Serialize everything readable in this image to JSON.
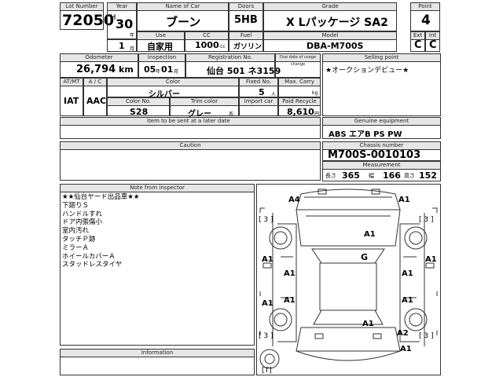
{
  "header": {
    "lot_number_label": "Lot Number",
    "lot_number": "72050",
    "year_label": "Year",
    "year_era": "H",
    "year_value": "30",
    "year_suffix": "年",
    "month_value": "1",
    "month_suffix": "月",
    "name_label": "Name of Car",
    "name_value": "ブーン",
    "use_label": "Use",
    "use_value": "自家用",
    "cc_label": "CC",
    "cc_value": "1000",
    "cc_unit": "cc",
    "doors_label": "Doors",
    "doors_value": "5HB",
    "fuel_label": "Fuel",
    "fuel_value": "ガソリン",
    "grade_label": "Grade",
    "grade_value": "X Lパッケージ SA2",
    "model_label": "Model",
    "model_value": "DBA-M700S",
    "point_label": "Point",
    "point_value": "4",
    "ext_label": "Ext",
    "ext_value": "C",
    "int_label": "Int",
    "int_value": "C"
  },
  "details": {
    "odometer_label": "Odometer",
    "odometer_value": "26,794",
    "odometer_unit": "km",
    "inspection_label": "Inspection",
    "inspection_year": "05",
    "inspection_year_suffix": "年",
    "inspection_month": "01",
    "inspection_month_suffix": "月",
    "registration_label": "Registration No.",
    "registration_value": "仙台 501 ネ3159",
    "due_date_label": "Due date of usage change",
    "selling_point_label": "Selling point",
    "selling_point_value": "★オークションデビュー★",
    "atmt_label": "AT/MT",
    "atmt_value": "IAT",
    "ac_label": "A / C",
    "ac_value": "AAC",
    "color_label": "Color",
    "color_value": "シルバー",
    "fixed_no_label": "Fixed No.",
    "fixed_no_value": "5",
    "fixed_no_unit": "人",
    "max_carry_label": "Max. Carry",
    "max_carry_unit": "kg",
    "color_no_label": "Color No.",
    "color_no_value": "S28",
    "trim_color_label": "Trim color",
    "trim_color_value": "グレー",
    "trim_color_unit": "系",
    "import_car_label": "Import car",
    "recycle_label": "Paid Recycle",
    "recycle_value": "8,610",
    "recycle_unit": "円",
    "item_label": "Item to be sent at a later date",
    "equipment_label": "Genuine equipment",
    "equipment_value": "ABS エアB PS PW",
    "caution_label": "Caution",
    "chassis_label": "Chassis number",
    "chassis_value": "M700S-0010103",
    "measurement_label": "Measurement",
    "length_label": "長さ",
    "length_value": "365",
    "width_label": "幅",
    "width_value": "166",
    "height_label": "高さ",
    "height_value": "152"
  },
  "inspector": {
    "label": "Note from inspector",
    "lines": [
      "★★仙台ヤード出品車★★",
      "下廻りＳ",
      "ハンドルすれ",
      "ドア内張傷小",
      "室内汚れ",
      "タッチＰ跡",
      "ミラーＡ",
      "ホイールカバーＡ",
      "スタッドレスタイヤ"
    ]
  },
  "information_label": "Information",
  "diagram": {
    "marks": [
      "A4",
      "A1",
      "A1",
      "A1",
      "A1",
      "G",
      "A1",
      "A1",
      "A1",
      "A1",
      "A1",
      "A1",
      "A2",
      "A1"
    ],
    "tire_marks": [
      "[ 3 ]",
      "[ 3 ]",
      "[ 3 ]",
      "[ 3 ]",
      "[T]"
    ]
  }
}
